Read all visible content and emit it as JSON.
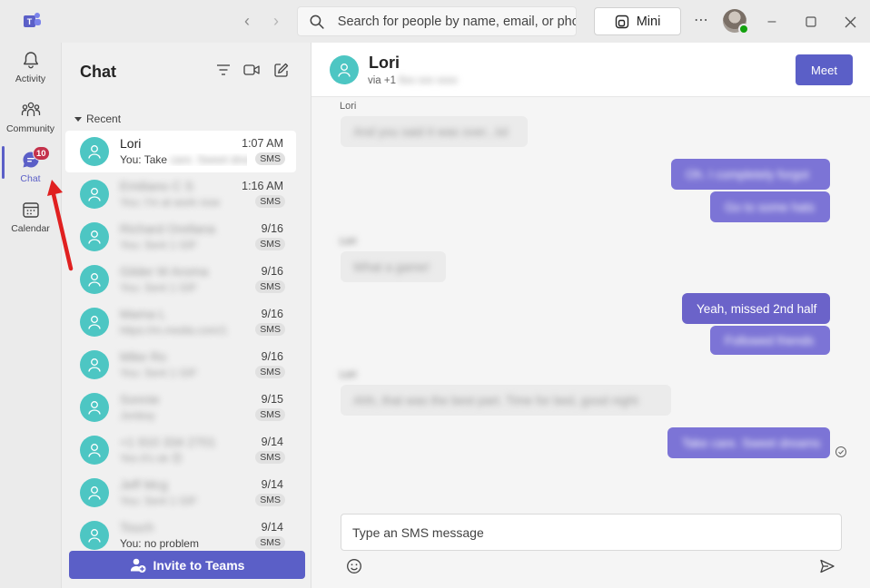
{
  "titlebar": {
    "search_placeholder": "Search for people by name, email, or phc",
    "mini_label": "Mini",
    "more_icon": "more-icon"
  },
  "rail": {
    "items": [
      {
        "label": "Activity",
        "icon": "bell-icon"
      },
      {
        "label": "Community",
        "icon": "community-icon"
      },
      {
        "label": "Chat",
        "icon": "chat-icon",
        "badge": "10",
        "active": true
      },
      {
        "label": "Calendar",
        "icon": "calendar-icon"
      }
    ]
  },
  "chatlist": {
    "title": "Chat",
    "section_label": "Recent",
    "items": [
      {
        "name": "Lori",
        "preview": "You: Take",
        "preview_hidden": "care. Sweet dreams",
        "time": "1:07 AM",
        "tag": "SMS",
        "selected": true
      },
      {
        "name": "Emiliano C S",
        "preview": "You: I'm at work now",
        "time": "1:16 AM",
        "tag": "SMS"
      },
      {
        "name": "Richard Orellana",
        "preview": "You: Sent 1 GIF",
        "time": "9/16",
        "tag": "SMS"
      },
      {
        "name": "Gilder M Aroma",
        "preview": "You: Sent 1 GIF",
        "time": "9/16",
        "tag": "SMS"
      },
      {
        "name": "Mama L",
        "preview": "https://m.media.com/1",
        "time": "9/16",
        "tag": "SMS"
      },
      {
        "name": "Mike Ro",
        "preview": "You: Sent 1 GIF",
        "time": "9/16",
        "tag": "SMS"
      },
      {
        "name": "Sonnie",
        "preview": "Jonboy",
        "time": "9/15",
        "tag": "SMS"
      },
      {
        "name": "+1 910 334 2701",
        "preview": "Yes it's ok 😊",
        "time": "9/14",
        "tag": "SMS"
      },
      {
        "name": "Jeff Mcg",
        "preview": "You: Sent 1 GIF",
        "time": "9/14",
        "tag": "SMS"
      },
      {
        "name": "Touch",
        "preview": "You: no problem",
        "time": "9/14",
        "tag": "SMS"
      }
    ],
    "invite_label": "Invite to Teams"
  },
  "conversation": {
    "name": "Lori",
    "subtitle_prefix": "via +1 ",
    "subtitle_hidden": "6xx xxx xxxx",
    "meet_label": "Meet",
    "messages": [
      {
        "dir": "in",
        "sender": "Lori",
        "text": "And you said it was over...lol",
        "blurred": true
      },
      {
        "dir": "out",
        "text": "Oh. I completely forgot",
        "blurred": true
      },
      {
        "dir": "out",
        "text": "Go to some hats",
        "blurred": true
      },
      {
        "dir": "in",
        "sender": "Lori",
        "text": "What a game!",
        "blurred": true
      },
      {
        "dir": "out",
        "text": "Yeah, missed 2nd half",
        "blurred": false
      },
      {
        "dir": "out",
        "text": "Followed friends",
        "blurred": true
      },
      {
        "dir": "in",
        "sender": "Lori",
        "text": "Ahh, that was the best part. Time for bed, good night",
        "blurred": true
      },
      {
        "dir": "out",
        "text": "Take care. Sweet dreams",
        "blurred": true
      }
    ],
    "compose_placeholder": "Type an SMS message"
  },
  "colors": {
    "accent": "#5b5fc7",
    "avatar": "#4dc6c3",
    "badge": "#c4314b",
    "annotation_arrow": "#e02020"
  }
}
